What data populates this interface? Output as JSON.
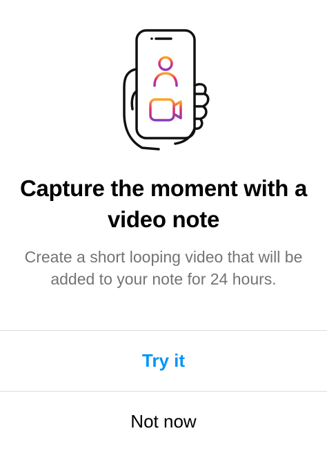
{
  "dialog": {
    "title": "Capture the moment with a video note",
    "body": "Create a short looping video that will be added to your note for 24 hours.",
    "illustration_icons": [
      "phone-in-hand-icon",
      "person-icon",
      "video-camera-icon"
    ],
    "colors": {
      "accent_blue": "#0095f6",
      "secondary_text": "#737373",
      "divider": "#dbdbdb",
      "gradient_start": "#f9a825",
      "gradient_end": "#c13584"
    }
  },
  "actions": {
    "primary_label": "Try it",
    "secondary_label": "Not now"
  }
}
